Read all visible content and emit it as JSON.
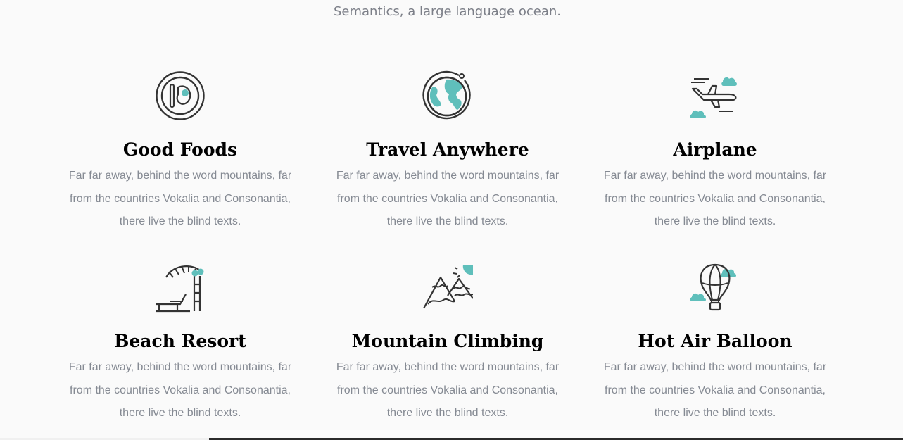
{
  "intro_text": "Semantics, a large language ocean.",
  "colors": {
    "accent": "#5fbfbb",
    "icon_stroke": "#333333",
    "heading": "#000000",
    "body_text": "#858a93"
  },
  "services": [
    {
      "icon": "food-plate-icon",
      "title": "Good Foods",
      "description": "Far far away, behind the word mountains, far from the countries Vokalia and Consonantia, there live the blind texts."
    },
    {
      "icon": "globe-icon",
      "title": "Travel Anywhere",
      "description": "Far far away, behind the word mountains, far from the countries Vokalia and Consonantia, there live the blind texts."
    },
    {
      "icon": "airplane-icon",
      "title": "Airplane",
      "description": "Far far away, behind the word mountains, far from the countries Vokalia and Consonantia, there live the blind texts."
    },
    {
      "icon": "beach-resort-icon",
      "title": "Beach Resort",
      "description": "Far far away, behind the word mountains, far from the countries Vokalia and Consonantia, there live the blind texts."
    },
    {
      "icon": "mountain-icon",
      "title": "Mountain Climbing",
      "description": "Far far away, behind the word mountains, far from the countries Vokalia and Consonantia, there live the blind texts."
    },
    {
      "icon": "hot-air-balloon-icon",
      "title": "Hot Air Balloon",
      "description": "Far far away, behind the word mountains, far from the countries Vokalia and Consonantia, there live the blind texts."
    }
  ]
}
